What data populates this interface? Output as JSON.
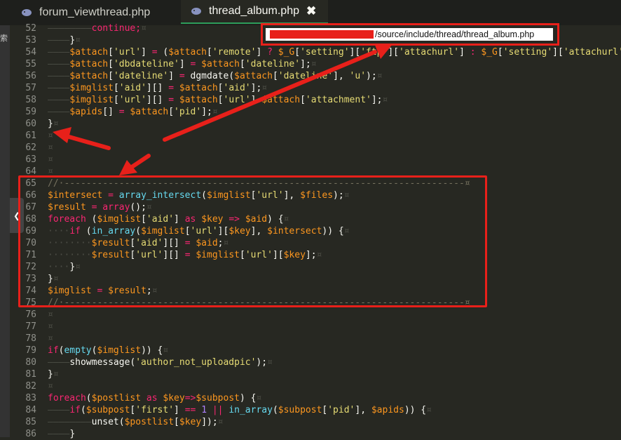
{
  "tabs": [
    {
      "label": "forum_viewthread.php",
      "active": false,
      "icon": "php-elephant-icon"
    },
    {
      "label": "thread_album.php",
      "active": true,
      "icon": "php-elephant-icon",
      "close": "✖"
    }
  ],
  "sidebar": {
    "text": "索",
    "collapse_glyph": "❮"
  },
  "tooltip": {
    "path": "/source/include/thread/thread_album.php"
  },
  "colors": {
    "accent_red": "#e8201a",
    "editor_bg": "#272822",
    "active_tab_underline": "#2d9d5a"
  },
  "code_lines": [
    {
      "n": "52",
      "tokens": [
        {
          "t": "————————",
          "c": "ind"
        },
        {
          "t": "continue;",
          "c": "k"
        },
        {
          "t": "¤",
          "c": "e"
        }
      ]
    },
    {
      "n": "53",
      "tokens": [
        {
          "t": "————",
          "c": "ind"
        },
        {
          "t": "}",
          "c": "p"
        },
        {
          "t": "¤",
          "c": "e"
        }
      ]
    },
    {
      "n": "54",
      "tokens": [
        {
          "t": "————",
          "c": "ind"
        },
        {
          "t": "$attach",
          "c": "v"
        },
        {
          "t": "[",
          "c": "p"
        },
        {
          "t": "'url'",
          "c": "s"
        },
        {
          "t": "] ",
          "c": "p"
        },
        {
          "t": "=",
          "c": "k"
        },
        {
          "t": " (",
          "c": "p"
        },
        {
          "t": "$attach",
          "c": "v"
        },
        {
          "t": "[",
          "c": "p"
        },
        {
          "t": "'remote'",
          "c": "s"
        },
        {
          "t": "] ",
          "c": "p"
        },
        {
          "t": "?",
          "c": "k"
        },
        {
          "t": " ",
          "c": "p"
        },
        {
          "t": "$_G",
          "c": "v"
        },
        {
          "t": "[",
          "c": "p"
        },
        {
          "t": "'setting'",
          "c": "s"
        },
        {
          "t": "][",
          "c": "p"
        },
        {
          "t": "'ftp'",
          "c": "s"
        },
        {
          "t": "][",
          "c": "p"
        },
        {
          "t": "'attachurl'",
          "c": "s"
        },
        {
          "t": "] ",
          "c": "p"
        },
        {
          "t": ":",
          "c": "k"
        },
        {
          "t": " ",
          "c": "p"
        },
        {
          "t": "$_G",
          "c": "v"
        },
        {
          "t": "[",
          "c": "p"
        },
        {
          "t": "'setting'",
          "c": "s"
        },
        {
          "t": "][",
          "c": "p"
        },
        {
          "t": "'attachurl'",
          "c": "s"
        },
        {
          "t": "])",
          "c": "p"
        }
      ]
    },
    {
      "n": "55",
      "tokens": [
        {
          "t": "————",
          "c": "ind"
        },
        {
          "t": "$attach",
          "c": "v"
        },
        {
          "t": "[",
          "c": "p"
        },
        {
          "t": "'dbdateline'",
          "c": "s"
        },
        {
          "t": "] ",
          "c": "p"
        },
        {
          "t": "=",
          "c": "k"
        },
        {
          "t": " ",
          "c": "p"
        },
        {
          "t": "$attach",
          "c": "v"
        },
        {
          "t": "[",
          "c": "p"
        },
        {
          "t": "'dateline'",
          "c": "s"
        },
        {
          "t": "];",
          "c": "p"
        },
        {
          "t": "¤",
          "c": "e"
        }
      ]
    },
    {
      "n": "56",
      "tokens": [
        {
          "t": "————",
          "c": "ind"
        },
        {
          "t": "$attach",
          "c": "v"
        },
        {
          "t": "[",
          "c": "p"
        },
        {
          "t": "'dateline'",
          "c": "s"
        },
        {
          "t": "] ",
          "c": "p"
        },
        {
          "t": "=",
          "c": "k"
        },
        {
          "t": " dgmdate(",
          "c": "p"
        },
        {
          "t": "$attach",
          "c": "v"
        },
        {
          "t": "[",
          "c": "p"
        },
        {
          "t": "'dateline'",
          "c": "s"
        },
        {
          "t": "], ",
          "c": "p"
        },
        {
          "t": "'u'",
          "c": "s"
        },
        {
          "t": ");",
          "c": "p"
        },
        {
          "t": "¤",
          "c": "e"
        }
      ]
    },
    {
      "n": "57",
      "tokens": [
        {
          "t": "————",
          "c": "ind"
        },
        {
          "t": "$imglist",
          "c": "v"
        },
        {
          "t": "[",
          "c": "p"
        },
        {
          "t": "'aid'",
          "c": "s"
        },
        {
          "t": "][] ",
          "c": "p"
        },
        {
          "t": "=",
          "c": "k"
        },
        {
          "t": " ",
          "c": "p"
        },
        {
          "t": "$attach",
          "c": "v"
        },
        {
          "t": "[",
          "c": "p"
        },
        {
          "t": "'aid'",
          "c": "s"
        },
        {
          "t": "];",
          "c": "p"
        },
        {
          "t": "¤",
          "c": "e"
        }
      ]
    },
    {
      "n": "58",
      "tokens": [
        {
          "t": "————",
          "c": "ind"
        },
        {
          "t": "$imglist",
          "c": "v"
        },
        {
          "t": "[",
          "c": "p"
        },
        {
          "t": "'url'",
          "c": "s"
        },
        {
          "t": "][] ",
          "c": "p"
        },
        {
          "t": "=",
          "c": "k"
        },
        {
          "t": " ",
          "c": "p"
        },
        {
          "t": "$attach",
          "c": "v"
        },
        {
          "t": "[",
          "c": "p"
        },
        {
          "t": "'url'",
          "c": "s"
        },
        {
          "t": "].",
          "c": "p"
        },
        {
          "t": "$attach",
          "c": "v"
        },
        {
          "t": "[",
          "c": "p"
        },
        {
          "t": "'attachment'",
          "c": "s"
        },
        {
          "t": "];",
          "c": "p"
        },
        {
          "t": "¤",
          "c": "e"
        }
      ]
    },
    {
      "n": "59",
      "tokens": [
        {
          "t": "————",
          "c": "ind"
        },
        {
          "t": "$apids",
          "c": "v"
        },
        {
          "t": "[] ",
          "c": "p"
        },
        {
          "t": "=",
          "c": "k"
        },
        {
          "t": " ",
          "c": "p"
        },
        {
          "t": "$attach",
          "c": "v"
        },
        {
          "t": "[",
          "c": "p"
        },
        {
          "t": "'pid'",
          "c": "s"
        },
        {
          "t": "];",
          "c": "p"
        },
        {
          "t": "¤",
          "c": "e"
        }
      ]
    },
    {
      "n": "60",
      "tokens": [
        {
          "t": "}",
          "c": "p"
        },
        {
          "t": "¤",
          "c": "e"
        }
      ]
    },
    {
      "n": "61",
      "tokens": [
        {
          "t": "¤",
          "c": "e"
        }
      ]
    },
    {
      "n": "62",
      "tokens": [
        {
          "t": "¤",
          "c": "e"
        }
      ]
    },
    {
      "n": "63",
      "tokens": [
        {
          "t": "¤",
          "c": "e"
        }
      ]
    },
    {
      "n": "64",
      "tokens": [
        {
          "t": "¤",
          "c": "e"
        }
      ]
    },
    {
      "n": "65",
      "tokens": [
        {
          "t": "//·-------------------------------------------------------------------------¤",
          "c": "c"
        }
      ]
    },
    {
      "n": "66",
      "tokens": [
        {
          "t": "$intersect",
          "c": "v"
        },
        {
          "t": " ",
          "c": "p"
        },
        {
          "t": "=",
          "c": "k"
        },
        {
          "t": " ",
          "c": "p"
        },
        {
          "t": "array_intersect",
          "c": "f"
        },
        {
          "t": "(",
          "c": "p"
        },
        {
          "t": "$imglist",
          "c": "v"
        },
        {
          "t": "[",
          "c": "p"
        },
        {
          "t": "'url'",
          "c": "s"
        },
        {
          "t": "], ",
          "c": "p"
        },
        {
          "t": "$files",
          "c": "v"
        },
        {
          "t": ");",
          "c": "p"
        },
        {
          "t": "¤",
          "c": "e"
        }
      ]
    },
    {
      "n": "67",
      "tokens": [
        {
          "t": "$result",
          "c": "v"
        },
        {
          "t": " ",
          "c": "p"
        },
        {
          "t": "=",
          "c": "k"
        },
        {
          "t": " ",
          "c": "p"
        },
        {
          "t": "array",
          "c": "k"
        },
        {
          "t": "();",
          "c": "p"
        },
        {
          "t": "¤",
          "c": "e"
        }
      ]
    },
    {
      "n": "68",
      "tokens": [
        {
          "t": "foreach",
          "c": "k"
        },
        {
          "t": " (",
          "c": "p"
        },
        {
          "t": "$imglist",
          "c": "v"
        },
        {
          "t": "[",
          "c": "p"
        },
        {
          "t": "'aid'",
          "c": "s"
        },
        {
          "t": "] ",
          "c": "p"
        },
        {
          "t": "as",
          "c": "k"
        },
        {
          "t": " ",
          "c": "p"
        },
        {
          "t": "$key",
          "c": "v"
        },
        {
          "t": " ",
          "c": "p"
        },
        {
          "t": "=>",
          "c": "k"
        },
        {
          "t": " ",
          "c": "p"
        },
        {
          "t": "$aid",
          "c": "v"
        },
        {
          "t": ") {",
          "c": "p"
        },
        {
          "t": "¤",
          "c": "e"
        }
      ]
    },
    {
      "n": "69",
      "tokens": [
        {
          "t": "····",
          "c": "ind"
        },
        {
          "t": "if",
          "c": "k"
        },
        {
          "t": " (",
          "c": "p"
        },
        {
          "t": "in_array",
          "c": "f"
        },
        {
          "t": "(",
          "c": "p"
        },
        {
          "t": "$imglist",
          "c": "v"
        },
        {
          "t": "[",
          "c": "p"
        },
        {
          "t": "'url'",
          "c": "s"
        },
        {
          "t": "][",
          "c": "p"
        },
        {
          "t": "$key",
          "c": "v"
        },
        {
          "t": "], ",
          "c": "p"
        },
        {
          "t": "$intersect",
          "c": "v"
        },
        {
          "t": ")) {",
          "c": "p"
        },
        {
          "t": "¤",
          "c": "e"
        }
      ]
    },
    {
      "n": "70",
      "tokens": [
        {
          "t": "········",
          "c": "ind"
        },
        {
          "t": "$result",
          "c": "v"
        },
        {
          "t": "[",
          "c": "p"
        },
        {
          "t": "'aid'",
          "c": "s"
        },
        {
          "t": "][] ",
          "c": "p"
        },
        {
          "t": "=",
          "c": "k"
        },
        {
          "t": " ",
          "c": "p"
        },
        {
          "t": "$aid",
          "c": "v"
        },
        {
          "t": ";",
          "c": "p"
        },
        {
          "t": "¤",
          "c": "e"
        }
      ]
    },
    {
      "n": "71",
      "tokens": [
        {
          "t": "········",
          "c": "ind"
        },
        {
          "t": "$result",
          "c": "v"
        },
        {
          "t": "[",
          "c": "p"
        },
        {
          "t": "'url'",
          "c": "s"
        },
        {
          "t": "][] ",
          "c": "p"
        },
        {
          "t": "=",
          "c": "k"
        },
        {
          "t": " ",
          "c": "p"
        },
        {
          "t": "$imglist",
          "c": "v"
        },
        {
          "t": "[",
          "c": "p"
        },
        {
          "t": "'url'",
          "c": "s"
        },
        {
          "t": "][",
          "c": "p"
        },
        {
          "t": "$key",
          "c": "v"
        },
        {
          "t": "];",
          "c": "p"
        },
        {
          "t": "¤",
          "c": "e"
        }
      ]
    },
    {
      "n": "72",
      "tokens": [
        {
          "t": "····",
          "c": "ind"
        },
        {
          "t": "}",
          "c": "p"
        },
        {
          "t": "¤",
          "c": "e"
        }
      ]
    },
    {
      "n": "73",
      "tokens": [
        {
          "t": "}",
          "c": "p"
        },
        {
          "t": "¤",
          "c": "e"
        }
      ]
    },
    {
      "n": "74",
      "tokens": [
        {
          "t": "$imglist",
          "c": "v"
        },
        {
          "t": " ",
          "c": "p"
        },
        {
          "t": "=",
          "c": "k"
        },
        {
          "t": " ",
          "c": "p"
        },
        {
          "t": "$result",
          "c": "v"
        },
        {
          "t": ";",
          "c": "p"
        },
        {
          "t": "¤",
          "c": "e"
        }
      ]
    },
    {
      "n": "75",
      "tokens": [
        {
          "t": "//·-------------------------------------------------------------------------¤",
          "c": "c"
        }
      ]
    },
    {
      "n": "76",
      "tokens": [
        {
          "t": "¤",
          "c": "e"
        }
      ]
    },
    {
      "n": "77",
      "tokens": [
        {
          "t": "¤",
          "c": "e"
        }
      ]
    },
    {
      "n": "78",
      "tokens": [
        {
          "t": "¤",
          "c": "e"
        }
      ]
    },
    {
      "n": "79",
      "tokens": [
        {
          "t": "if",
          "c": "k"
        },
        {
          "t": "(",
          "c": "p"
        },
        {
          "t": "empty",
          "c": "f"
        },
        {
          "t": "(",
          "c": "p"
        },
        {
          "t": "$imglist",
          "c": "v"
        },
        {
          "t": ")) {",
          "c": "p"
        },
        {
          "t": "¤",
          "c": "e"
        }
      ]
    },
    {
      "n": "80",
      "tokens": [
        {
          "t": "————",
          "c": "ind"
        },
        {
          "t": "showmessage(",
          "c": "p"
        },
        {
          "t": "'author_not_uploadpic'",
          "c": "s"
        },
        {
          "t": ");",
          "c": "p"
        },
        {
          "t": "¤",
          "c": "e"
        }
      ]
    },
    {
      "n": "81",
      "tokens": [
        {
          "t": "}",
          "c": "p"
        },
        {
          "t": "¤",
          "c": "e"
        }
      ]
    },
    {
      "n": "82",
      "tokens": [
        {
          "t": "¤",
          "c": "e"
        }
      ]
    },
    {
      "n": "83",
      "tokens": [
        {
          "t": "foreach",
          "c": "k"
        },
        {
          "t": "(",
          "c": "p"
        },
        {
          "t": "$postlist",
          "c": "v"
        },
        {
          "t": " ",
          "c": "p"
        },
        {
          "t": "as",
          "c": "k"
        },
        {
          "t": " ",
          "c": "p"
        },
        {
          "t": "$key",
          "c": "v"
        },
        {
          "t": "=>",
          "c": "k"
        },
        {
          "t": "$subpost",
          "c": "v"
        },
        {
          "t": ") {",
          "c": "p"
        },
        {
          "t": "¤",
          "c": "e"
        }
      ]
    },
    {
      "n": "84",
      "tokens": [
        {
          "t": "————",
          "c": "ind"
        },
        {
          "t": "if",
          "c": "k"
        },
        {
          "t": "(",
          "c": "p"
        },
        {
          "t": "$subpost",
          "c": "v"
        },
        {
          "t": "[",
          "c": "p"
        },
        {
          "t": "'first'",
          "c": "s"
        },
        {
          "t": "] ",
          "c": "p"
        },
        {
          "t": "==",
          "c": "k"
        },
        {
          "t": " ",
          "c": "p"
        },
        {
          "t": "1",
          "c": "n"
        },
        {
          "t": " ",
          "c": "p"
        },
        {
          "t": "||",
          "c": "k"
        },
        {
          "t": " ",
          "c": "p"
        },
        {
          "t": "in_array",
          "c": "f"
        },
        {
          "t": "(",
          "c": "p"
        },
        {
          "t": "$subpost",
          "c": "v"
        },
        {
          "t": "[",
          "c": "p"
        },
        {
          "t": "'pid'",
          "c": "s"
        },
        {
          "t": "], ",
          "c": "p"
        },
        {
          "t": "$apids",
          "c": "v"
        },
        {
          "t": ")) {",
          "c": "p"
        },
        {
          "t": "¤",
          "c": "e"
        }
      ]
    },
    {
      "n": "85",
      "tokens": [
        {
          "t": "————————",
          "c": "ind"
        },
        {
          "t": "unset",
          "c": "p"
        },
        {
          "t": "(",
          "c": "p"
        },
        {
          "t": "$postlist",
          "c": "v"
        },
        {
          "t": "[",
          "c": "p"
        },
        {
          "t": "$key",
          "c": "v"
        },
        {
          "t": "]);",
          "c": "p"
        },
        {
          "t": "¤",
          "c": "e"
        }
      ]
    },
    {
      "n": "86",
      "tokens": [
        {
          "t": "————",
          "c": "ind"
        },
        {
          "t": "}",
          "c": "p"
        }
      ]
    }
  ]
}
